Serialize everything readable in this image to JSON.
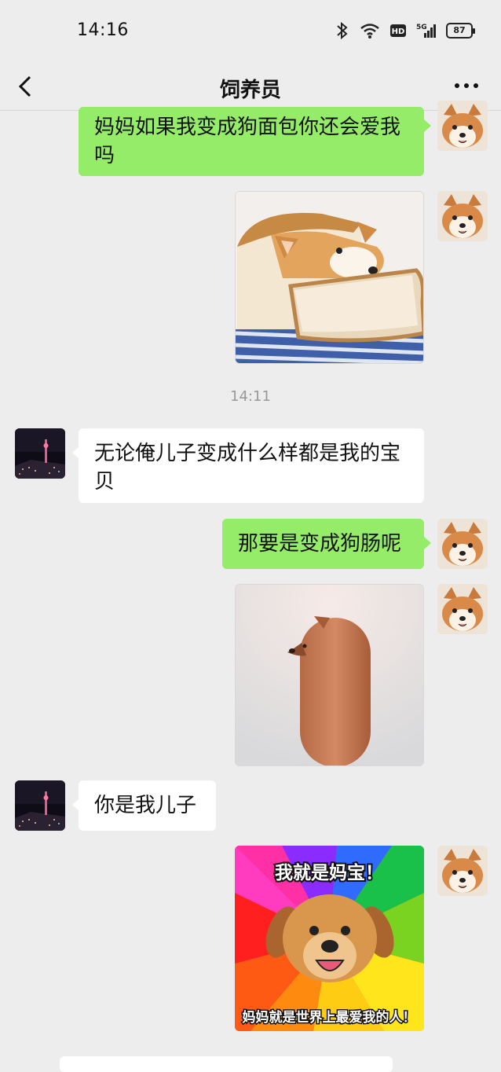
{
  "status": {
    "time": "14:16",
    "battery": "87",
    "network": "5G",
    "hd": "HD"
  },
  "nav": {
    "title": "饲养员"
  },
  "messages": {
    "m1": "妈妈如果我变成狗面包你还会爱我吗",
    "ts": "14:11",
    "m2": "无论俺儿子变成什么样都是我的宝贝",
    "m3": "那要是变成狗肠呢",
    "m4": "你是我儿子"
  },
  "sticker": {
    "top": "我就是妈宝！",
    "bottom": "妈妈就是世界上最爱我的人！"
  },
  "icons": {
    "back": "chevron-left-icon",
    "more": "more-dots-icon",
    "bluetooth": "bluetooth-icon",
    "wifi": "wifi-icon",
    "signal": "signal-icon"
  },
  "colors": {
    "bg": "#ededed",
    "my_bubble": "#95ec69",
    "other_bubble": "#ffffff",
    "timestamp": "#999999"
  }
}
